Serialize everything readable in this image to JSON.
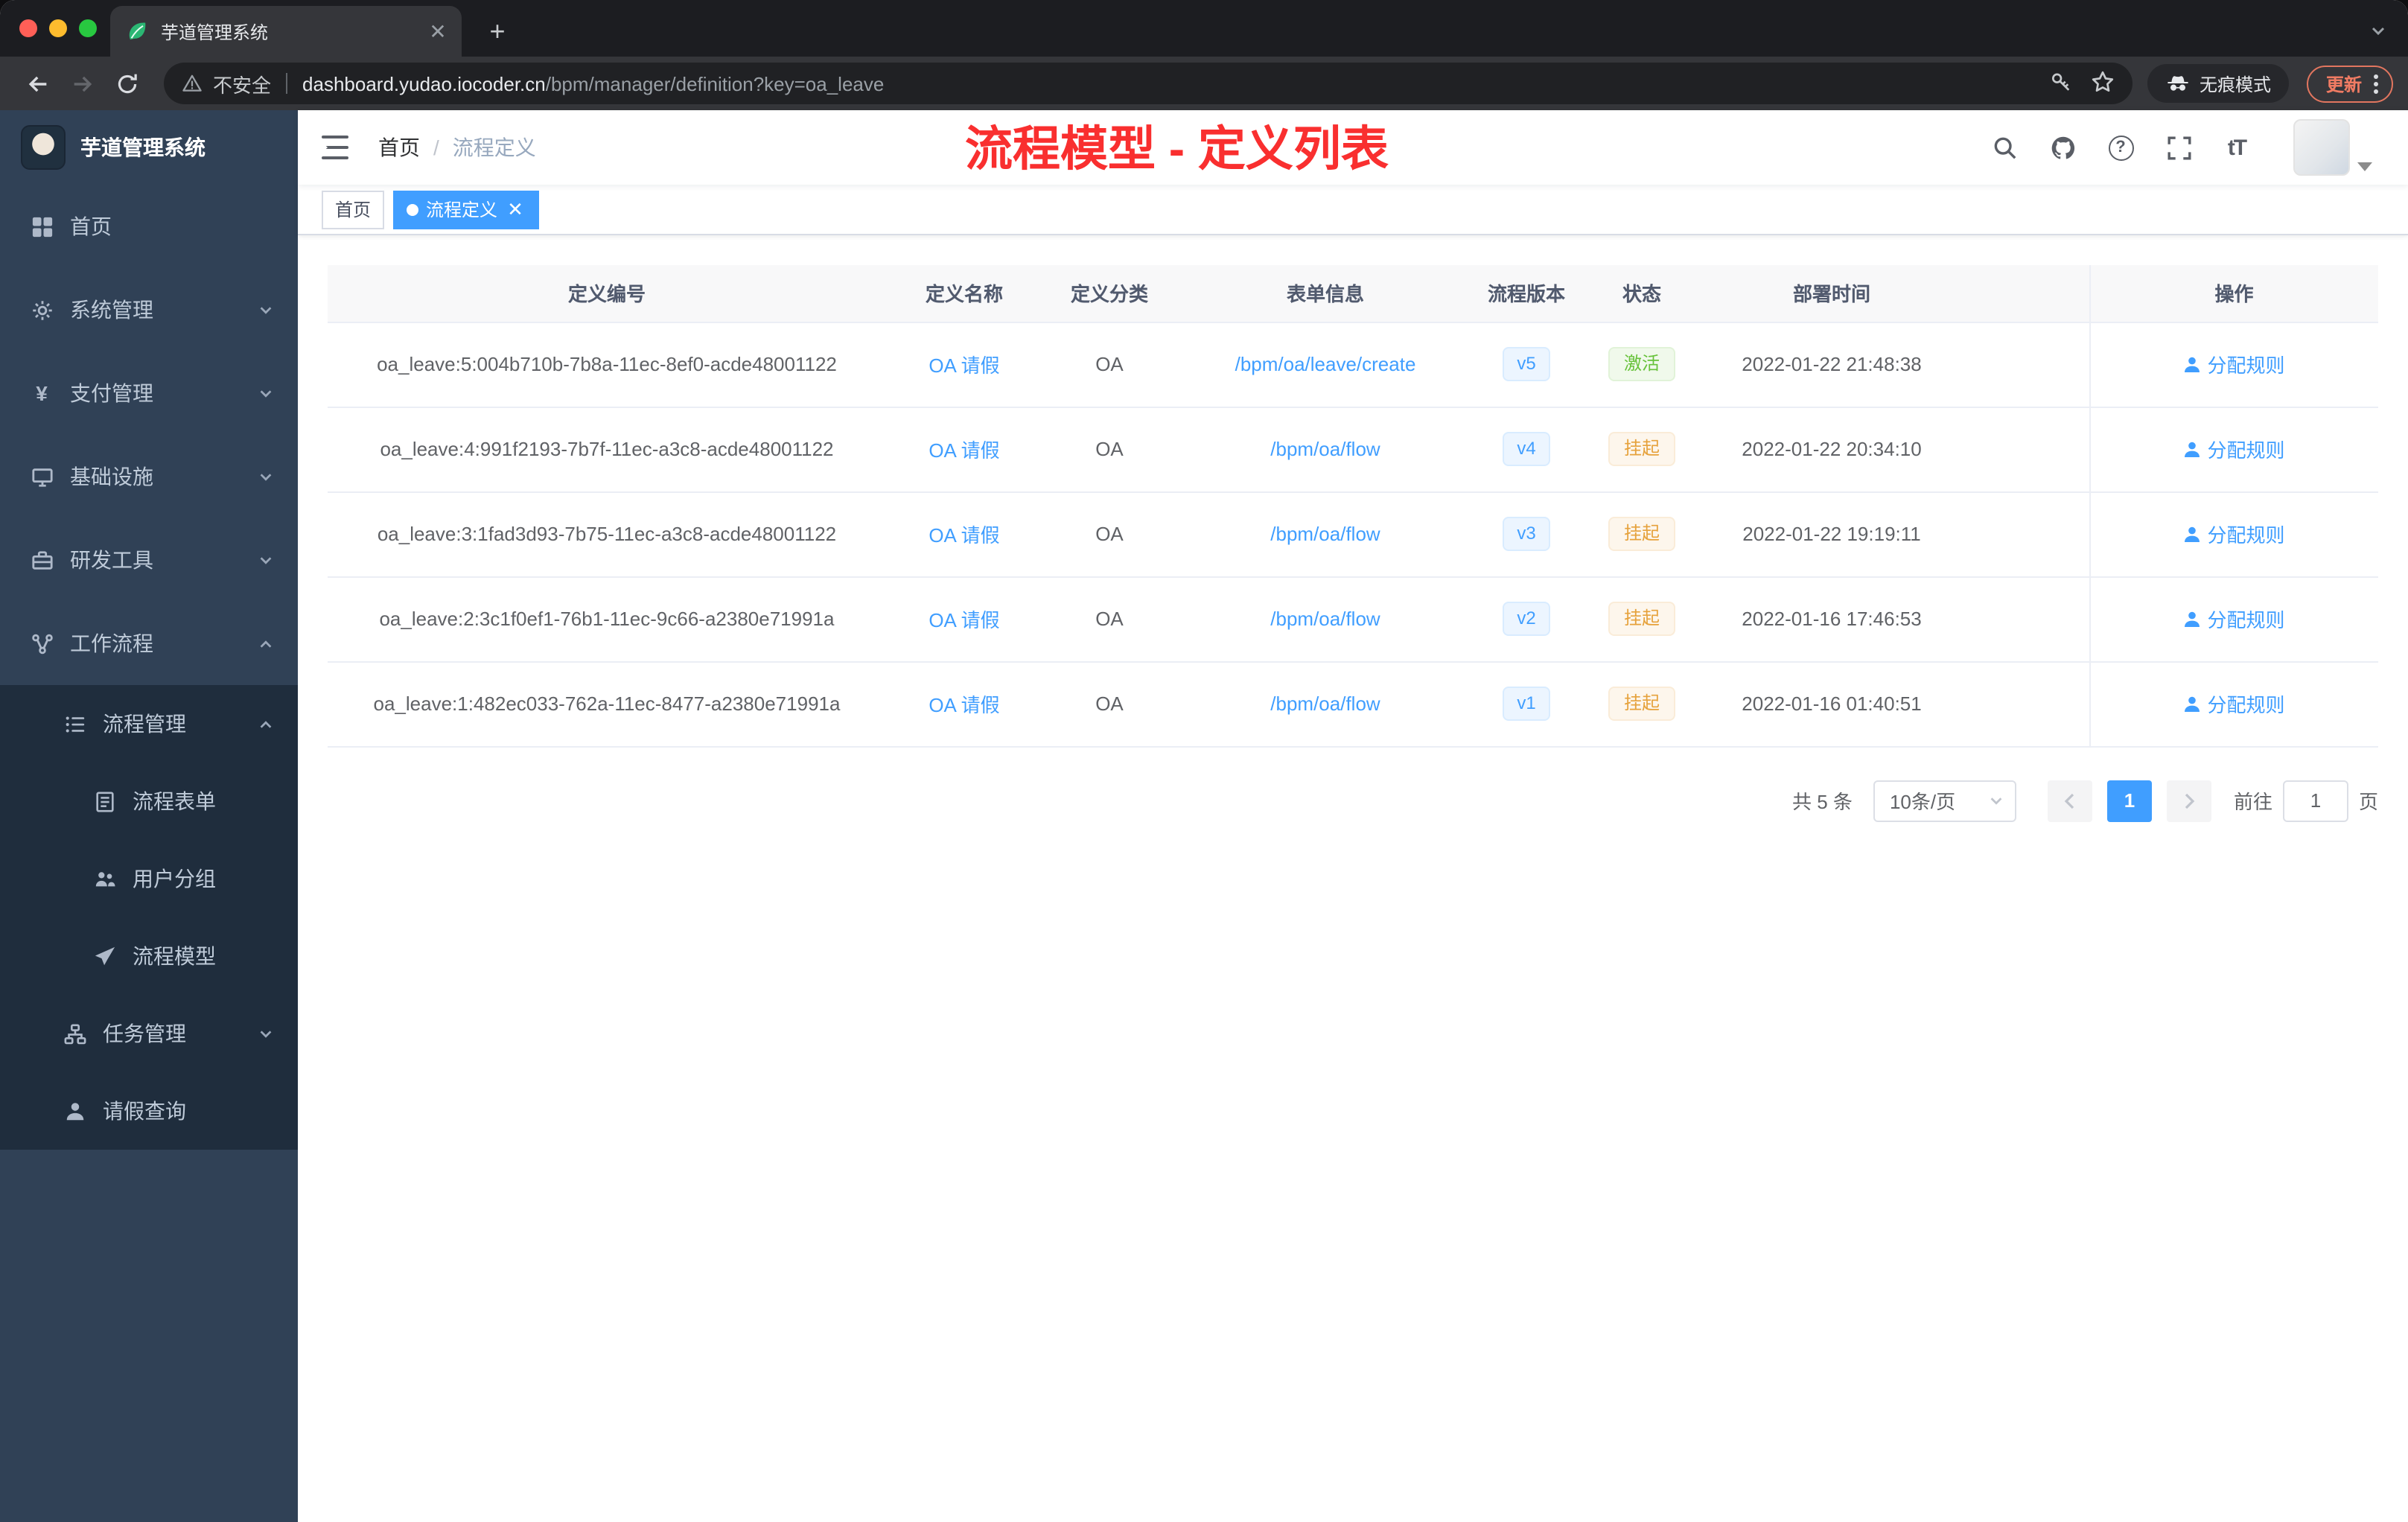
{
  "browser": {
    "tab_title": "芋道管理系统",
    "security_label": "不安全",
    "url_host": "dashboard.yudao.iocoder.cn",
    "url_path": "/bpm/manager/definition?key=oa_leave",
    "incognito_label": "无痕模式",
    "update_label": "更新"
  },
  "sidebar": {
    "logo_title": "芋道管理系统",
    "items": [
      {
        "key": "home",
        "label": "首页",
        "icon": "dashboard-icon"
      },
      {
        "key": "system",
        "label": "系统管理",
        "icon": "gear-icon",
        "arrow": "down"
      },
      {
        "key": "payment",
        "label": "支付管理",
        "icon": "yen-icon",
        "arrow": "down"
      },
      {
        "key": "infrastructure",
        "label": "基础设施",
        "icon": "monitor-icon",
        "arrow": "down"
      },
      {
        "key": "devtools",
        "label": "研发工具",
        "icon": "toolbox-icon",
        "arrow": "down"
      },
      {
        "key": "workflow",
        "label": "工作流程",
        "icon": "workflow-icon",
        "arrow": "up",
        "expanded": true,
        "children": [
          {
            "key": "process-manage",
            "label": "流程管理",
            "icon": "list-icon",
            "arrow": "up",
            "expanded": true,
            "children": [
              {
                "key": "process-form",
                "label": "流程表单",
                "icon": "form-icon"
              },
              {
                "key": "user-group",
                "label": "用户分组",
                "icon": "group-icon"
              },
              {
                "key": "process-model",
                "label": "流程模型",
                "icon": "send-icon"
              }
            ]
          },
          {
            "key": "task-manage",
            "label": "任务管理",
            "icon": "tree-icon",
            "arrow": "down"
          },
          {
            "key": "leave-query",
            "label": "请假查询",
            "icon": "user-icon"
          }
        ]
      }
    ]
  },
  "navbar": {
    "breadcrumb": [
      "首页",
      "流程定义"
    ],
    "annotation": "流程模型 - 定义列表",
    "right_icons": [
      {
        "key": "search",
        "icon": "search-icon"
      },
      {
        "key": "github",
        "icon": "github-icon"
      },
      {
        "key": "help",
        "icon": "help-icon"
      },
      {
        "key": "fullscreen",
        "icon": "fullscreen-icon"
      },
      {
        "key": "font-size",
        "icon": "font-size-icon"
      }
    ]
  },
  "tags": [
    {
      "key": "home",
      "label": "首页",
      "active": false,
      "closable": false
    },
    {
      "key": "process-definition",
      "label": "流程定义",
      "active": true,
      "closable": true
    }
  ],
  "table": {
    "columns": [
      "定义编号",
      "定义名称",
      "定义分类",
      "表单信息",
      "流程版本",
      "状态",
      "部署时间",
      "操作"
    ],
    "rows": [
      {
        "id": "oa_leave:5:004b710b-7b8a-11ec-8ef0-acde48001122",
        "name": "OA 请假",
        "category": "OA",
        "form": "/bpm/oa/leave/create",
        "version": "v5",
        "status": "激活",
        "status_type": "success",
        "deployed": "2022-01-22 21:48:38",
        "action": "分配规则"
      },
      {
        "id": "oa_leave:4:991f2193-7b7f-11ec-a3c8-acde48001122",
        "name": "OA 请假",
        "category": "OA",
        "form": "/bpm/oa/flow",
        "version": "v4",
        "status": "挂起",
        "status_type": "warning",
        "deployed": "2022-01-22 20:34:10",
        "action": "分配规则"
      },
      {
        "id": "oa_leave:3:1fad3d93-7b75-11ec-a3c8-acde48001122",
        "name": "OA 请假",
        "category": "OA",
        "form": "/bpm/oa/flow",
        "version": "v3",
        "status": "挂起",
        "status_type": "warning",
        "deployed": "2022-01-22 19:19:11",
        "action": "分配规则"
      },
      {
        "id": "oa_leave:2:3c1f0ef1-76b1-11ec-9c66-a2380e71991a",
        "name": "OA 请假",
        "category": "OA",
        "form": "/bpm/oa/flow",
        "version": "v2",
        "status": "挂起",
        "status_type": "warning",
        "deployed": "2022-01-16 17:46:53",
        "action": "分配规则"
      },
      {
        "id": "oa_leave:1:482ec033-762a-11ec-8477-a2380e71991a",
        "name": "OA 请假",
        "category": "OA",
        "form": "/bpm/oa/flow",
        "version": "v1",
        "status": "挂起",
        "status_type": "warning",
        "deployed": "2022-01-16 01:40:51",
        "action": "分配规则"
      }
    ]
  },
  "pagination": {
    "total": "共 5 条",
    "page_size": "10条/页",
    "current_page": "1",
    "goto_label": "前往",
    "goto_value": "1",
    "goto_suffix": "页"
  },
  "colors": {
    "accent": "#409eff",
    "success": "#67c23a",
    "warning": "#e6a23c",
    "annotation_red": "#f92f2f",
    "sidebar_bg": "#304156",
    "submenu_bg": "#1f2d3d"
  }
}
